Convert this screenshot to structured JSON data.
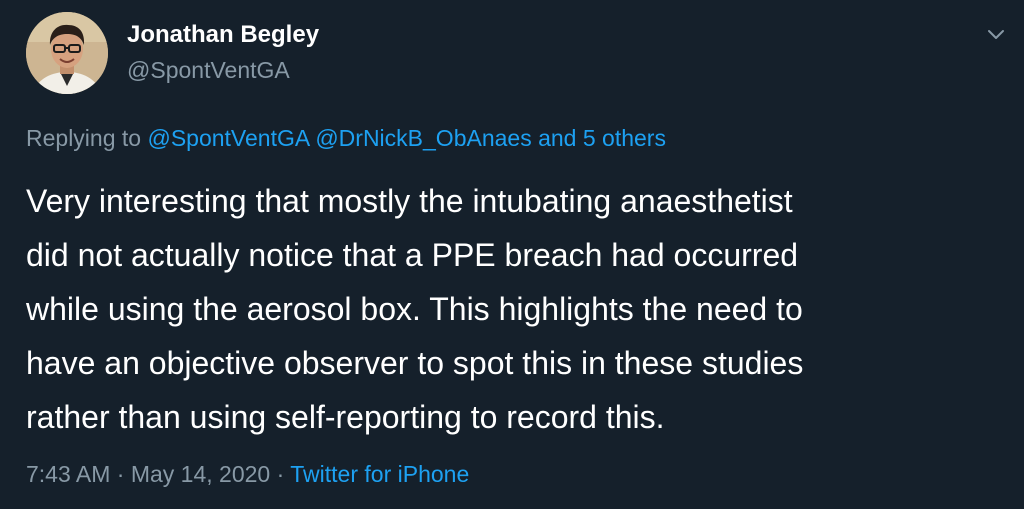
{
  "user": {
    "name": "Jonathan Begley",
    "handle": "@SpontVentGA"
  },
  "reply": {
    "prefix": "Replying to",
    "mention_1": "@SpontVentGA",
    "mention_2": "@DrNickB_ObAnaes",
    "others": "and 5 others"
  },
  "tweet": {
    "lines": [
      "Very interesting that mostly the intubating anaesthetist",
      "did not actually notice that a PPE breach had occurred",
      "while using the aerosol box. This highlights the need to",
      "have an objective observer to spot this in these studies",
      "rather than using self-reporting to record this."
    ]
  },
  "meta": {
    "time": "7:43 AM",
    "separator": "·",
    "date": "May 14, 2020",
    "source": "Twitter for iPhone"
  },
  "colors": {
    "background": "#15202b",
    "text": "#ffffff",
    "muted": "#8899a6",
    "link": "#1da1f2"
  },
  "icons": {
    "menu": "chevron-down-icon",
    "avatar": "profile-photo"
  }
}
